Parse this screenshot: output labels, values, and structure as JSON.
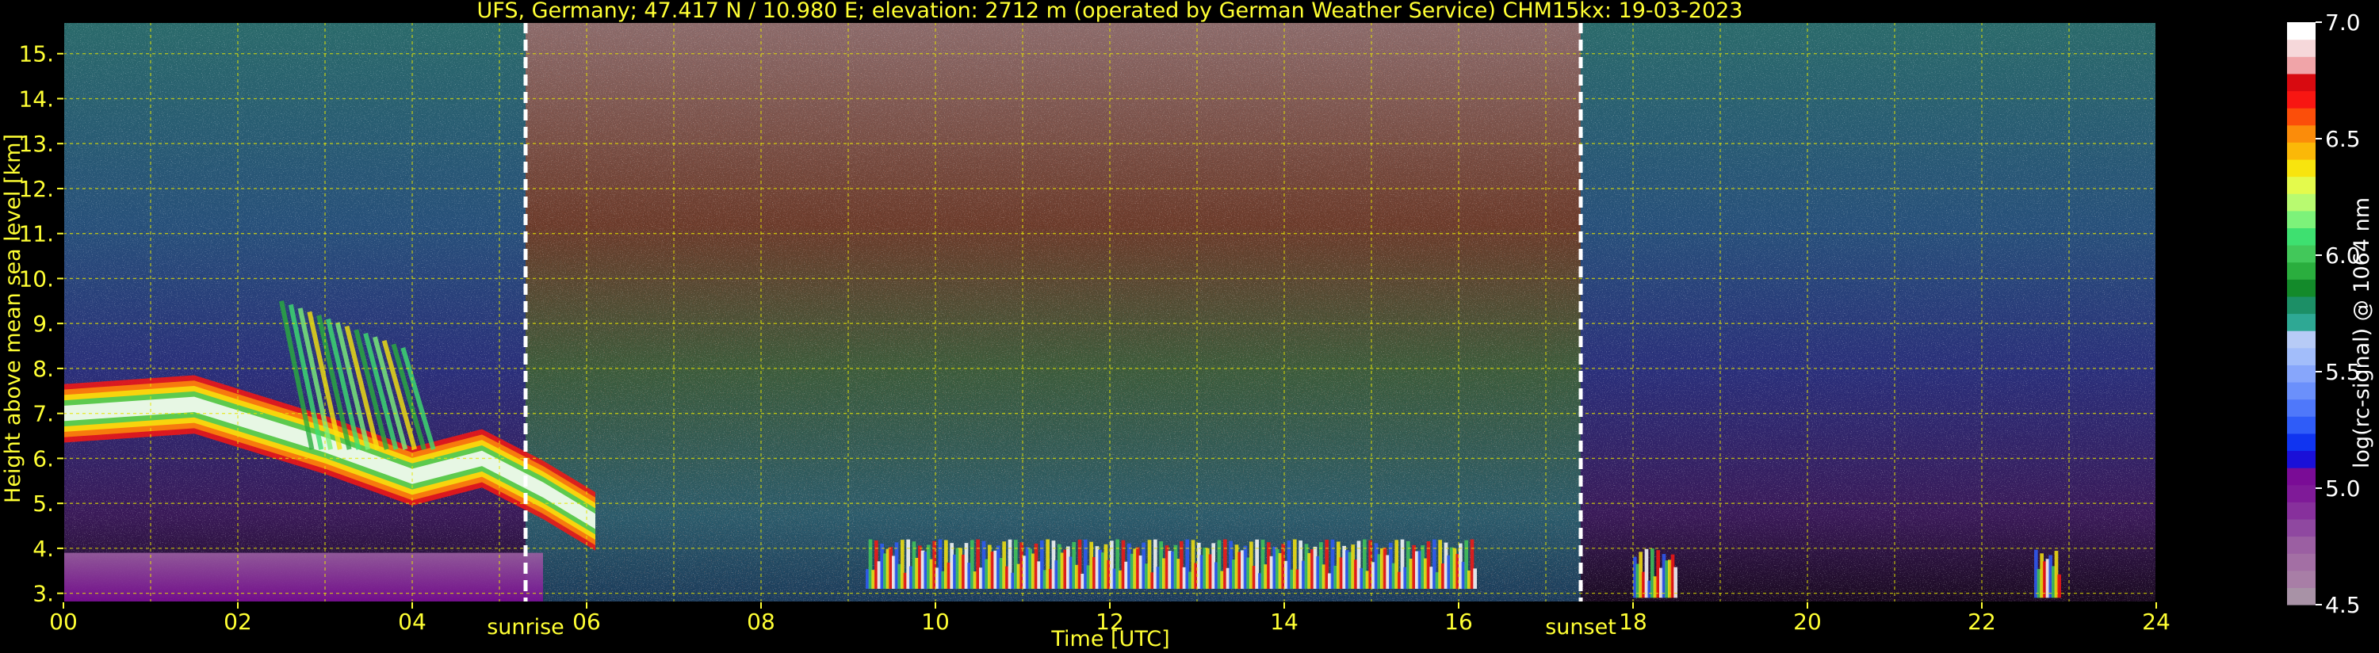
{
  "chart_data": {
    "type": "heatmap",
    "title": "UFS, Germany; 47.417 N / 10.980 E; elevation: 2712 m  (operated by German Weather Service)    CHM15kx: 19-03-2023",
    "xlabel": "Time [UTC]",
    "ylabel": "Height above mean sea level [km]",
    "xlim": [
      0,
      24
    ],
    "ylim": [
      2.8,
      15.7
    ],
    "x_ticks": [
      "00",
      "02",
      "04",
      "06",
      "08",
      "10",
      "12",
      "14",
      "16",
      "18",
      "20",
      "22",
      "24"
    ],
    "y_ticks": [
      "3.",
      "4.",
      "5.",
      "6.",
      "7.",
      "8.",
      "9.",
      "10.",
      "11.",
      "12.",
      "13.",
      "14.",
      "15."
    ],
    "grid": true,
    "markers": [
      {
        "label": "sunrise",
        "x": 5.3
      },
      {
        "label": "sunset",
        "x": 17.4
      }
    ],
    "colorbar": {
      "label": "log(rc-signal) @ 1064 nm",
      "range": [
        4.5,
        7.0
      ],
      "ticks": [
        "4.5",
        "5.0",
        "5.5",
        "6.0",
        "6.5",
        "7.0"
      ],
      "colors": [
        "#a892a6",
        "#a87ea6",
        "#a36fa4",
        "#9b5fa2",
        "#8f48a0",
        "#87309c",
        "#7f1a98",
        "#7a0c96",
        "#1a10d8",
        "#1034f0",
        "#2f5cf8",
        "#4f78fa",
        "#6b90fb",
        "#87a6fb",
        "#a2bdfa",
        "#b7cbf6",
        "#2ea894",
        "#1c8f66",
        "#138a2a",
        "#2aae3e",
        "#42c85a",
        "#3ee070",
        "#7df27a",
        "#b8fa70",
        "#e4fa4c",
        "#f8e40e",
        "#fbb808",
        "#fb8c0a",
        "#fb4e0a",
        "#f81612",
        "#d80a10",
        "#f0a4a8",
        "#f6d8da",
        "#ffffff"
      ]
    },
    "features": [
      {
        "type": "cloud-layer",
        "x": [
          0.0,
          1.5,
          3.0,
          4.0,
          4.8,
          5.5,
          6.1
        ],
        "y": [
          7.0,
          7.2,
          6.3,
          5.6,
          6.0,
          5.3,
          4.6
        ]
      },
      {
        "type": "cirrus",
        "x": [
          2.5,
          3.0,
          3.5,
          4.0
        ],
        "y": [
          9.5,
          8.0,
          7.0,
          6.0
        ]
      },
      {
        "type": "boundary-layer",
        "x": [
          0,
          5.5
        ],
        "y": [
          2.8,
          3.9
        ]
      },
      {
        "type": "low-clouds",
        "x": [
          9.2,
          16.2
        ],
        "y": [
          3.1,
          4.2
        ]
      },
      {
        "type": "low-clouds",
        "x": [
          18.0,
          18.5
        ],
        "y": [
          2.9,
          4.0
        ]
      },
      {
        "type": "low-clouds",
        "x": [
          22.6,
          22.9
        ],
        "y": [
          2.9,
          4.0
        ]
      }
    ]
  }
}
